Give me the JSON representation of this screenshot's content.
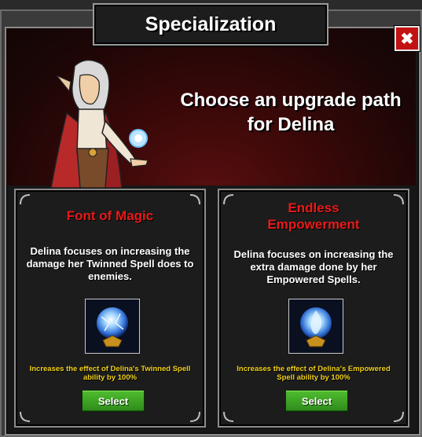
{
  "window": {
    "title": "Specialization",
    "close_label": "✖"
  },
  "hero": {
    "heading_line1": "Choose an upgrade path",
    "heading_line2": "for Delina"
  },
  "options": [
    {
      "title_line1": "Font of Magic",
      "title_line2": "",
      "description": "Delina focuses on increasing the damage her Twinned Spell does to enemies.",
      "icon": "blue-orb-icon",
      "effect": "Increases the effect of Delina's Twinned Spell ability by 100%",
      "button_label": "Select"
    },
    {
      "title_line1": "Endless",
      "title_line2": "Empowerment",
      "description": "Delina focuses on increasing the extra damage done by her Empowered Spells.",
      "icon": "blue-flame-orb-icon",
      "effect": "Increases the effect of Delina's Empowered Spell ability by 100%",
      "button_label": "Select"
    }
  ],
  "colors": {
    "title_red": "#e81a1a",
    "effect_yellow": "#f2d21a",
    "button_green": "#3fa526",
    "close_red": "#c21212"
  }
}
